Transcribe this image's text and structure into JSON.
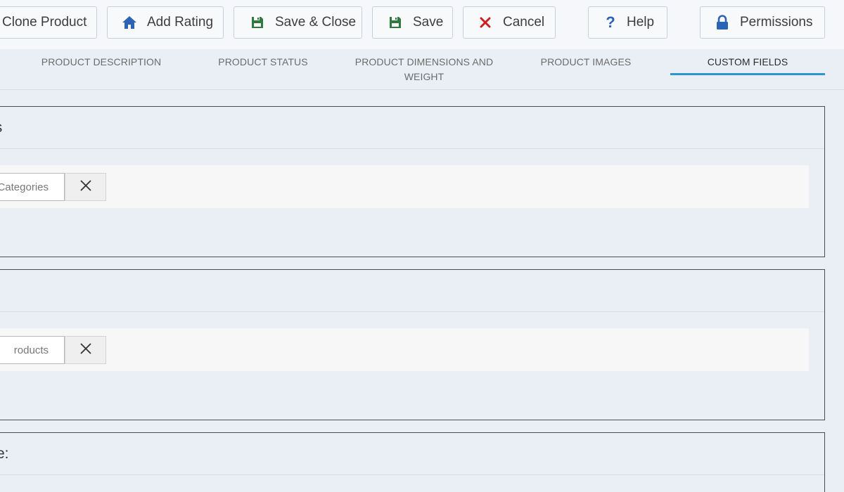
{
  "toolbar": {
    "buttons": [
      {
        "label": "Clone Product",
        "icon": "clone-icon"
      },
      {
        "label": "Add Rating",
        "icon": "home-icon"
      },
      {
        "label": "Save & Close",
        "icon": "floppy-disk-icon"
      },
      {
        "label": "Save",
        "icon": "floppy-disk-icon"
      },
      {
        "label": "Cancel",
        "icon": "close-icon"
      },
      {
        "label": "Help",
        "icon": "question-icon"
      },
      {
        "label": "Permissions",
        "icon": "lock-icon"
      }
    ]
  },
  "tabs": [
    {
      "label": "PRODUCT DESCRIPTION",
      "active": false
    },
    {
      "label": "PRODUCT STATUS",
      "active": false
    },
    {
      "label": "PRODUCT DIMENSIONS AND WEIGHT",
      "active": false
    },
    {
      "label": "PRODUCT IMAGES",
      "active": false
    },
    {
      "label": "CUSTOM FIELDS",
      "active": true
    }
  ],
  "panels": [
    {
      "title": "gories",
      "select_value": "Categories"
    },
    {
      "title": "ucts",
      "select_value": "roducts"
    },
    {
      "title": "l Type:"
    }
  ],
  "colors": {
    "accent": "#2a97cf",
    "icon_blue": "#2b63b5",
    "icon_green": "#2f7a3d",
    "icon_red": "#cc2020"
  }
}
